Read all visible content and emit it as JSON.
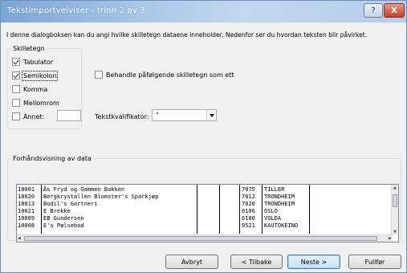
{
  "window": {
    "title": "Tekstimportveiviser - trinn 2 av 3",
    "help_icon": "?",
    "close_icon": "X"
  },
  "intro_text": "I denne dialogboksen kan du angi hvilke skilletegn dataene inneholder. Nedenfor ser du hvordan teksten blir påvirket.",
  "delimiters": {
    "group_label": "Skilletegn",
    "tab": {
      "label": "Tabulator",
      "checked": true
    },
    "semicolon": {
      "label": "Semikolon",
      "checked": true
    },
    "comma": {
      "label": "Komma",
      "checked": false
    },
    "space": {
      "label": "Mellomrom",
      "checked": false
    },
    "other": {
      "label": "Annet:",
      "checked": false,
      "value": ""
    }
  },
  "consecutive": {
    "label": "Behandle påfølgende skilletegn som ett",
    "checked": false
  },
  "text_qualifier": {
    "label": "Tekstkvalifikator:",
    "value": "\""
  },
  "preview": {
    "group_label": "Forhåndsvisning av data",
    "rows": [
      [
        "10001",
        "Ås Fryd og Gammen Bakken",
        "",
        "",
        "7075",
        "TILLER"
      ],
      [
        "10020",
        "Bergkrystallen Blomster's Sparkjøp",
        "",
        "",
        "7012",
        "TRONDHEIM"
      ],
      [
        "10013",
        "Bodil's Gartneri",
        "",
        "",
        "7020",
        "TRONDHEIM"
      ],
      [
        "10021",
        "E Brekke",
        "",
        "",
        "0106",
        "OSLO"
      ],
      [
        "10009",
        "EB Gundersen",
        "",
        "",
        "6100",
        "VOLDA"
      ],
      [
        "10008",
        "E's Pølsebod",
        "",
        "",
        "9521",
        "KAUTOKEINO"
      ]
    ]
  },
  "buttons": {
    "cancel": "Avbryt",
    "back": "< Tilbake",
    "next": "Neste >",
    "finish": "Fullfør"
  }
}
